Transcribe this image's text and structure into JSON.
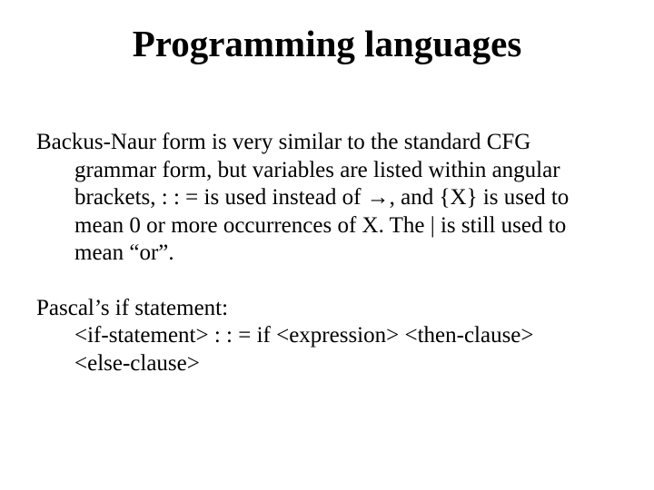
{
  "title": "Programming languages",
  "para1_line1": "Backus-Naur form is very similar to the standard CFG",
  "para1_rest": "grammar form, but variables are listed within angular brackets, : : = is used instead of →, and {X} is used to mean 0 or more occurrences of X.  The | is still used to mean “or”.",
  "para2_line1": "Pascal’s if statement:",
  "para2_line2": "<if-statement> : : = if <expression> <then-clause>",
  "para2_line3": "<else-clause>"
}
